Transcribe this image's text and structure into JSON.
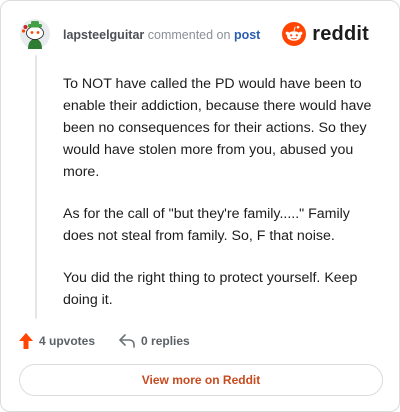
{
  "header": {
    "username": "lapsteelguitar",
    "action": "commented on",
    "post_link": "post",
    "brand": "reddit"
  },
  "icons": {
    "avatar": "snoo-avatar-icon",
    "brand_logo": "reddit-logo-icon",
    "upvote": "upvote-arrow-icon",
    "reply": "reply-arrow-icon"
  },
  "colors": {
    "brand_orange": "#ff4500",
    "link_blue": "#2a5db0",
    "view_more_text": "#c64b1f"
  },
  "comment": {
    "paragraphs": [
      "To NOT have called the PD would have been to enable their addiction, because there would have been no consequences for their actions. So they would have stolen more from you, abused you more.",
      "As for the call of \"but they're family.....\" Family does not steal from family. So, F that noise.",
      "You did the right thing to protect yourself. Keep doing it."
    ]
  },
  "actions": {
    "upvotes": "4 upvotes",
    "replies": "0 replies"
  },
  "footer": {
    "view_more": "View more on Reddit"
  }
}
